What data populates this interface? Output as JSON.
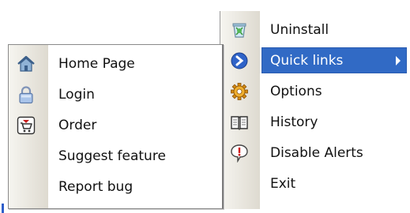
{
  "main_menu": {
    "items": [
      {
        "label": "Uninstall",
        "icon": "uninstall-icon"
      },
      {
        "label": "Quick links",
        "icon": "quick-links-icon",
        "highlighted": true,
        "submenu": true
      },
      {
        "label": "Options",
        "icon": "gear-icon"
      },
      {
        "label": "History",
        "icon": "book-icon"
      },
      {
        "label": "Disable Alerts",
        "icon": "alert-bubble-icon"
      },
      {
        "label": "Exit",
        "icon": ""
      }
    ]
  },
  "submenu": {
    "items": [
      {
        "label": "Home Page",
        "icon": "home-icon"
      },
      {
        "label": "Login",
        "icon": "lock-icon"
      },
      {
        "label": "Order",
        "icon": "cart-icon"
      },
      {
        "label": "Suggest feature",
        "icon": ""
      },
      {
        "label": "Report bug",
        "icon": ""
      }
    ]
  },
  "colors": {
    "highlight": "#316ac5",
    "gutter": "#e8e6df"
  }
}
